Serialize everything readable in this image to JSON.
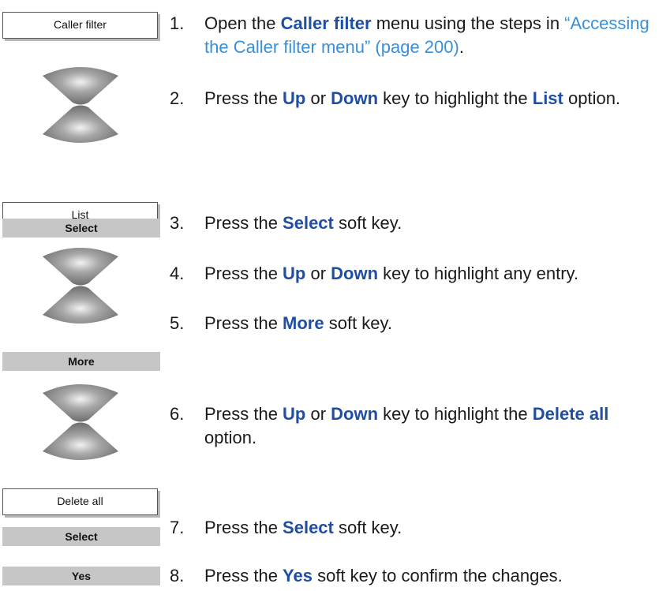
{
  "left_column": {
    "caller_filter_screen": "Caller filter",
    "list_screen": "List",
    "select_softkey_1": "Select",
    "more_softkey": "More",
    "delete_all_screen": "Delete all",
    "select_softkey_2": "Select",
    "yes_softkey": "Yes"
  },
  "steps": [
    {
      "num": "1.",
      "a": "Open the ",
      "k1": "Caller filter",
      "b": " menu using the steps in ",
      "link": "“Accessing the Caller filter menu” (page 200)",
      "c": "."
    },
    {
      "num": "2.",
      "a": "Press the ",
      "k1": "Up",
      "b": " or ",
      "k2": "Down",
      "c": " key to highlight the ",
      "k3": "List",
      "d": " option."
    },
    {
      "num": "3.",
      "a": "Press the ",
      "k1": "Select",
      "b": " soft key."
    },
    {
      "num": "4.",
      "a": "Press the ",
      "k1": "Up",
      "b": " or ",
      "k2": "Down",
      "c": " key to highlight any entry."
    },
    {
      "num": "5.",
      "a": "Press the ",
      "k1": "More",
      "b": " soft key."
    },
    {
      "num": "6.",
      "a": "Press the ",
      "k1": "Up",
      "b": " or ",
      "k2": "Down",
      "c": " key to highlight the ",
      "k3": "Delete all",
      "d": " option."
    },
    {
      "num": "7.",
      "a": "Press the ",
      "k1": "Select",
      "b": " soft key."
    },
    {
      "num": "8.",
      "a": "Press the ",
      "k1": "Yes",
      "b": " soft key to confirm the changes."
    }
  ],
  "icons": {
    "navigation_key": "up-down-navigation-key-icon"
  },
  "colors": {
    "keyword": "#1f4ea3",
    "link": "#3a8fd9",
    "softkey_bg": "#c6c6c6"
  }
}
